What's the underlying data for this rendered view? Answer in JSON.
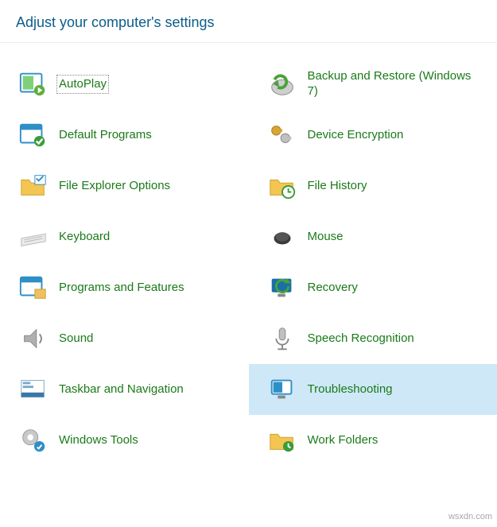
{
  "header": {
    "title": "Adjust your computer's settings"
  },
  "items": [
    {
      "name": "autoplay",
      "label": "AutoPlay",
      "icon": "autoplay-icon",
      "focused": true
    },
    {
      "name": "backup-restore",
      "label": "Backup and Restore (Windows 7)",
      "icon": "backup-icon"
    },
    {
      "name": "default-programs",
      "label": "Default Programs",
      "icon": "default-programs-icon"
    },
    {
      "name": "device-encryption",
      "label": "Device Encryption",
      "icon": "device-encryption-icon"
    },
    {
      "name": "file-explorer-options",
      "label": "File Explorer Options",
      "icon": "folder-options-icon"
    },
    {
      "name": "file-history",
      "label": "File History",
      "icon": "file-history-icon"
    },
    {
      "name": "keyboard",
      "label": "Keyboard",
      "icon": "keyboard-icon"
    },
    {
      "name": "mouse",
      "label": "Mouse",
      "icon": "mouse-icon"
    },
    {
      "name": "programs-features",
      "label": "Programs and Features",
      "icon": "programs-features-icon"
    },
    {
      "name": "recovery",
      "label": "Recovery",
      "icon": "recovery-icon"
    },
    {
      "name": "sound",
      "label": "Sound",
      "icon": "sound-icon"
    },
    {
      "name": "speech-recognition",
      "label": "Speech Recognition",
      "icon": "speech-icon"
    },
    {
      "name": "taskbar-navigation",
      "label": "Taskbar and Navigation",
      "icon": "taskbar-icon"
    },
    {
      "name": "troubleshooting",
      "label": "Troubleshooting",
      "icon": "troubleshooting-icon",
      "hovered": true
    },
    {
      "name": "windows-tools",
      "label": "Windows Tools",
      "icon": "windows-tools-icon"
    },
    {
      "name": "work-folders",
      "label": "Work Folders",
      "icon": "work-folders-icon"
    }
  ],
  "watermark": "wsxdn.com"
}
